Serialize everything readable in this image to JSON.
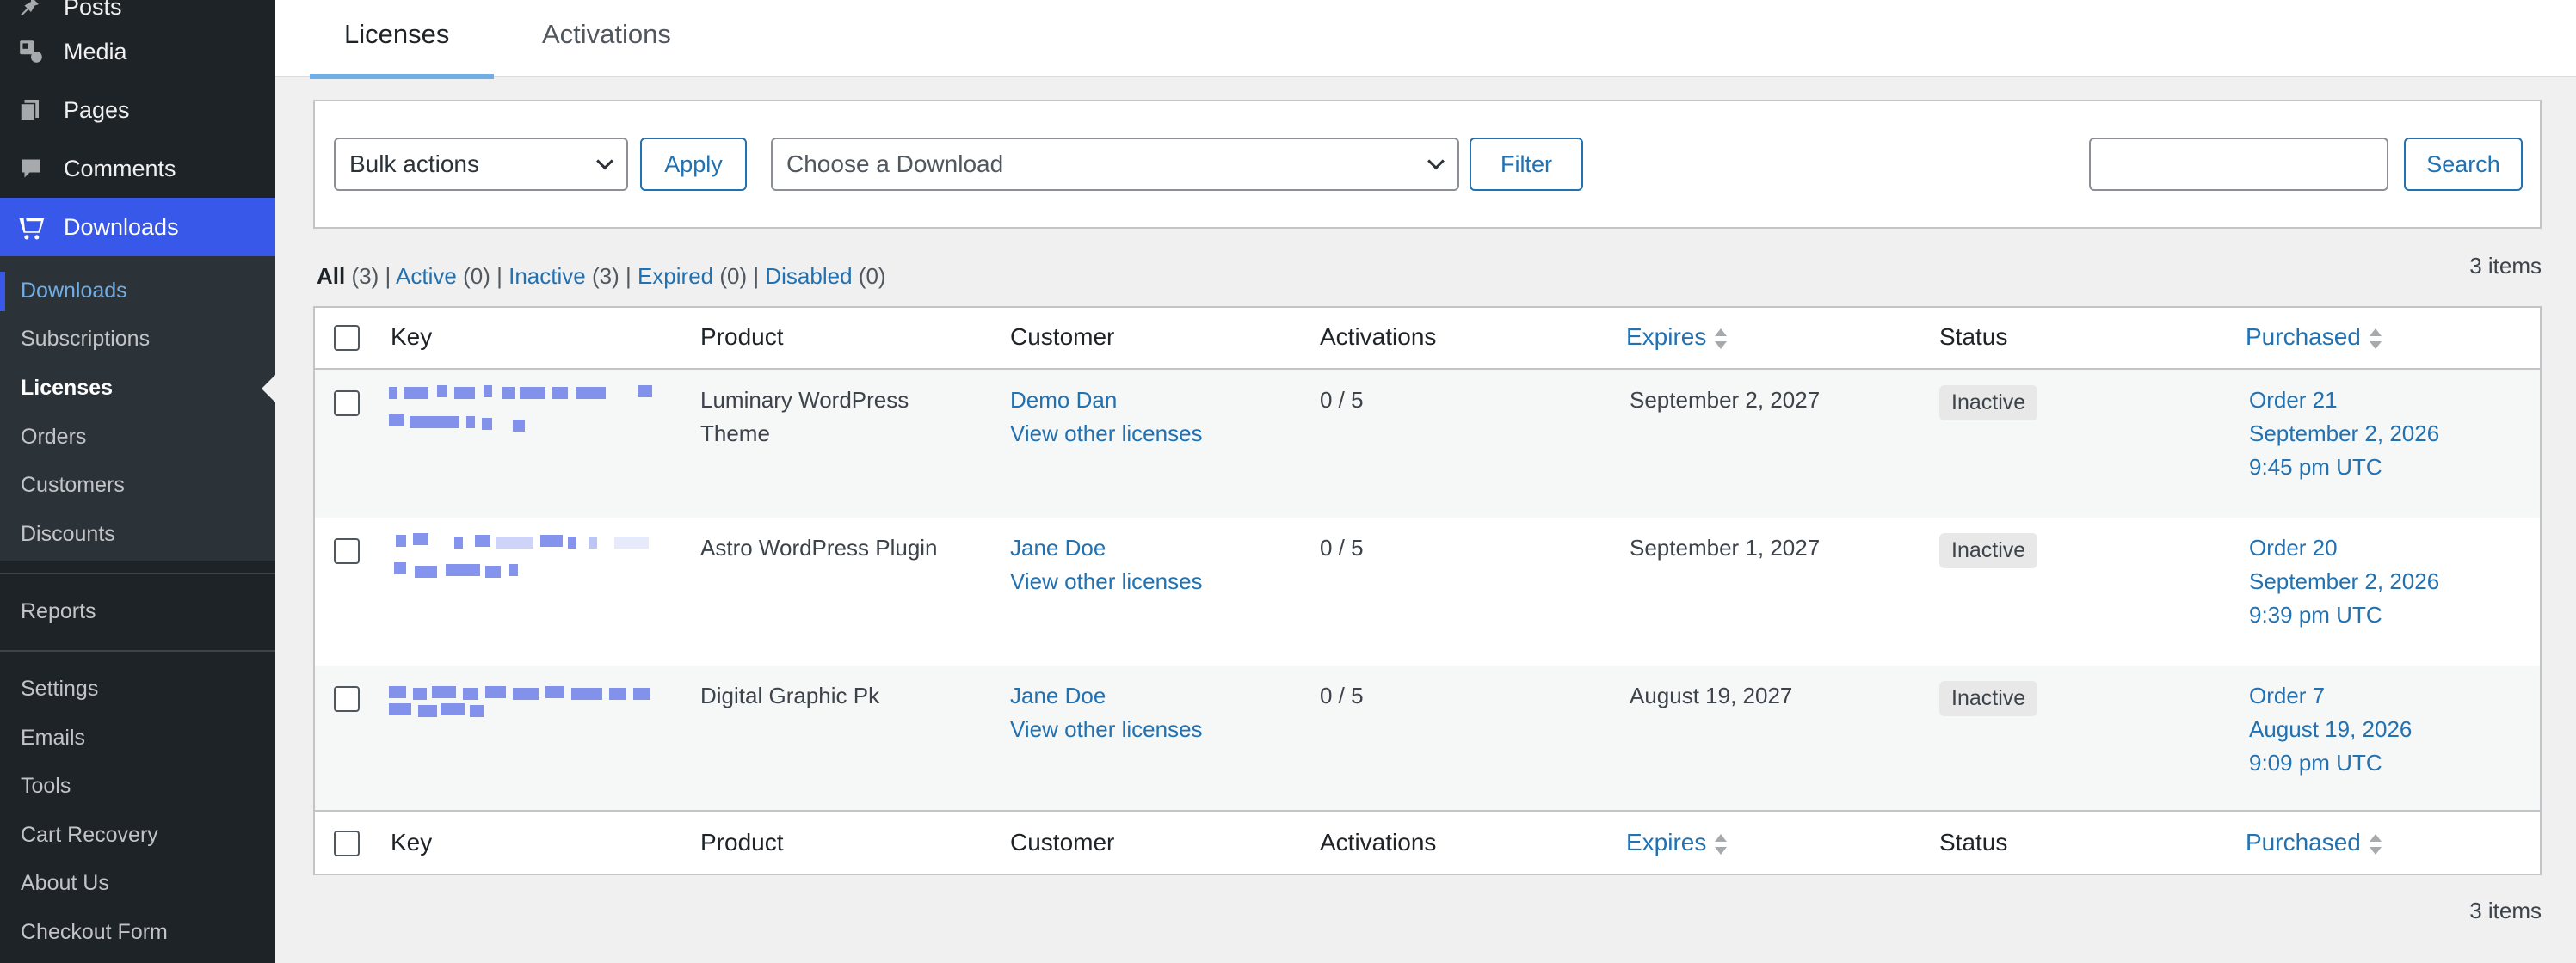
{
  "sidebar": {
    "top_items": [
      {
        "label": "Posts",
        "icon": "pin-icon"
      },
      {
        "label": "Media",
        "icon": "media-icon"
      },
      {
        "label": "Pages",
        "icon": "pages-icon"
      },
      {
        "label": "Comments",
        "icon": "comment-icon"
      },
      {
        "label": "Downloads",
        "icon": "download-icon"
      }
    ],
    "submenu": [
      "Downloads",
      "Subscriptions",
      "Licenses",
      "Orders",
      "Customers",
      "Discounts"
    ],
    "bottom_items": [
      "Reports",
      "Settings",
      "Emails",
      "Tools",
      "Cart Recovery",
      "About Us",
      "Checkout Form"
    ]
  },
  "tabs": [
    {
      "label": "Licenses",
      "active": true
    },
    {
      "label": "Activations",
      "active": false
    }
  ],
  "filters": {
    "bulk_select": "Bulk actions",
    "apply_label": "Apply",
    "download_select": "Choose a Download",
    "filter_label": "Filter",
    "search_value": "",
    "search_label": "Search"
  },
  "views": {
    "all": "All",
    "all_count": "(3)",
    "active": "Active",
    "active_count": "(0)",
    "inactive": "Inactive",
    "inactive_count": "(3)",
    "expired": "Expired",
    "expired_count": "(0)",
    "disabled": "Disabled",
    "disabled_count": "(0)",
    "sep": "|"
  },
  "items_count": "3 items",
  "table": {
    "columns": {
      "key": "Key",
      "product": "Product",
      "customer": "Customer",
      "activations": "Activations",
      "expires": "Expires",
      "status": "Status",
      "purchased": "Purchased"
    },
    "rows": [
      {
        "product_line1": "Luminary WordPress",
        "product_line2": "Theme",
        "customer": "Demo Dan",
        "view_licenses": "View other licenses",
        "activations": "0 / 5",
        "expires": "September 2, 2027",
        "status": "Inactive",
        "order": "Order 21",
        "purchased_date": "September 2, 2026",
        "purchased_time": "9:45 pm UTC"
      },
      {
        "product_line1": "Astro WordPress Plugin",
        "product_line2": "",
        "customer": "Jane Doe",
        "view_licenses": "View other licenses",
        "activations": "0 / 5",
        "expires": "September 1, 2027",
        "status": "Inactive",
        "order": "Order 20",
        "purchased_date": "September 2, 2026",
        "purchased_time": "9:39 pm UTC"
      },
      {
        "product_line1": "Digital Graphic Pk",
        "product_line2": "",
        "customer": "Jane Doe",
        "view_licenses": "View other licenses",
        "activations": "0 / 5",
        "expires": "August 19, 2027",
        "status": "Inactive",
        "order": "Order 7",
        "purchased_date": "August 19, 2026",
        "purchased_time": "9:09 pm UTC"
      }
    ]
  },
  "colors": {
    "sidebar_bg": "#1d2327",
    "accent": "#3858e9",
    "link": "#2271b1"
  }
}
